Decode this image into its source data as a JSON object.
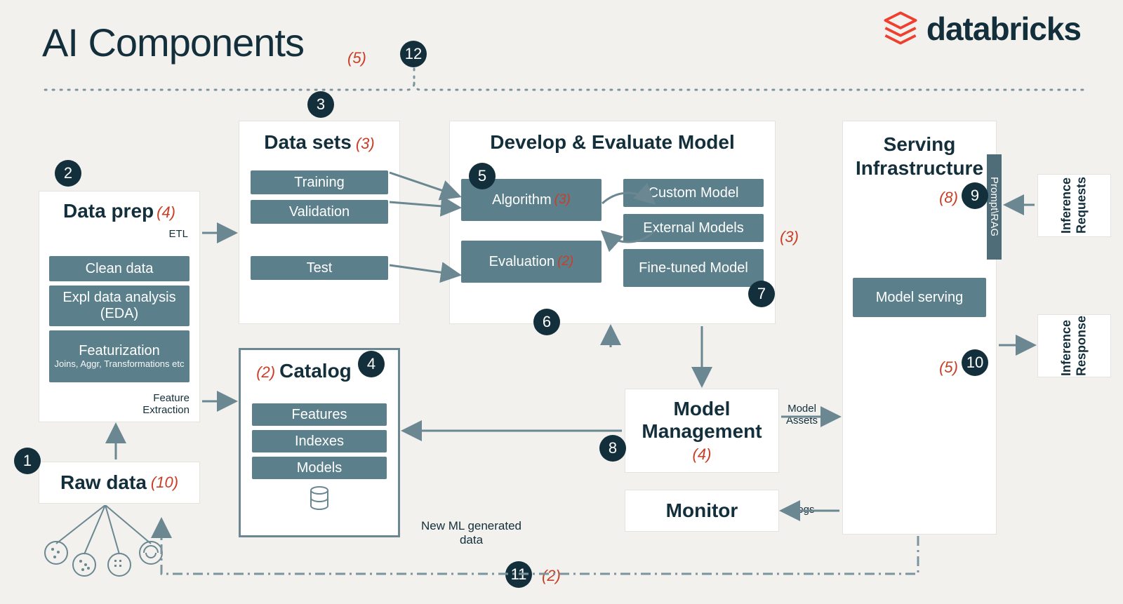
{
  "title": "AI Components",
  "brand": "databricks",
  "top_red": "(5)",
  "badges": {
    "n1": "1",
    "n2": "2",
    "n3": "3",
    "n4": "4",
    "n5": "5",
    "n6": "6",
    "n7": "7",
    "n8": "8",
    "n9": "9",
    "n10": "10",
    "n11": "11",
    "n12": "12"
  },
  "raw_data": {
    "title": "Raw data",
    "red": "(10)"
  },
  "data_prep": {
    "title": "Data prep",
    "red": "(4)",
    "etl": "ETL",
    "feat": "Feature\nExtraction",
    "chips": [
      "Clean data",
      "Expl data analysis (EDA)",
      "Featurization"
    ],
    "feat_sub": "Joins, Aggr, Transformations etc"
  },
  "data_sets": {
    "title": "Data sets",
    "red": "(3)",
    "chips": [
      "Training",
      "Validation",
      "Test"
    ]
  },
  "catalog": {
    "title": "Catalog",
    "red": "(2)",
    "chips": [
      "Features",
      "Indexes",
      "Models"
    ]
  },
  "develop": {
    "title": "Develop & Evaluate Model",
    "algorithm": {
      "label": "Algorithm",
      "red": "(3)"
    },
    "evaluation": {
      "label": "Evaluation",
      "red": "(2)"
    },
    "models": [
      "Custom Model",
      "External Models",
      "Fine-tuned Model"
    ],
    "ext_red": "(3)"
  },
  "model_mgmt": {
    "title": "Model Management",
    "red": "(4)"
  },
  "monitor": {
    "title": "Monitor"
  },
  "serving": {
    "title": "Serving Infrastructure",
    "red_top": "(8)",
    "red_bot": "(5)",
    "chip": "Model serving",
    "side": "Prompt\\RAG"
  },
  "inference_req": "Inference Requests",
  "inference_res": "Inference Response",
  "labels": {
    "model_assets": "Model\nAssets",
    "logs": "Logs",
    "new_ml": "New ML generated data",
    "new_ml_red": "(2)"
  }
}
